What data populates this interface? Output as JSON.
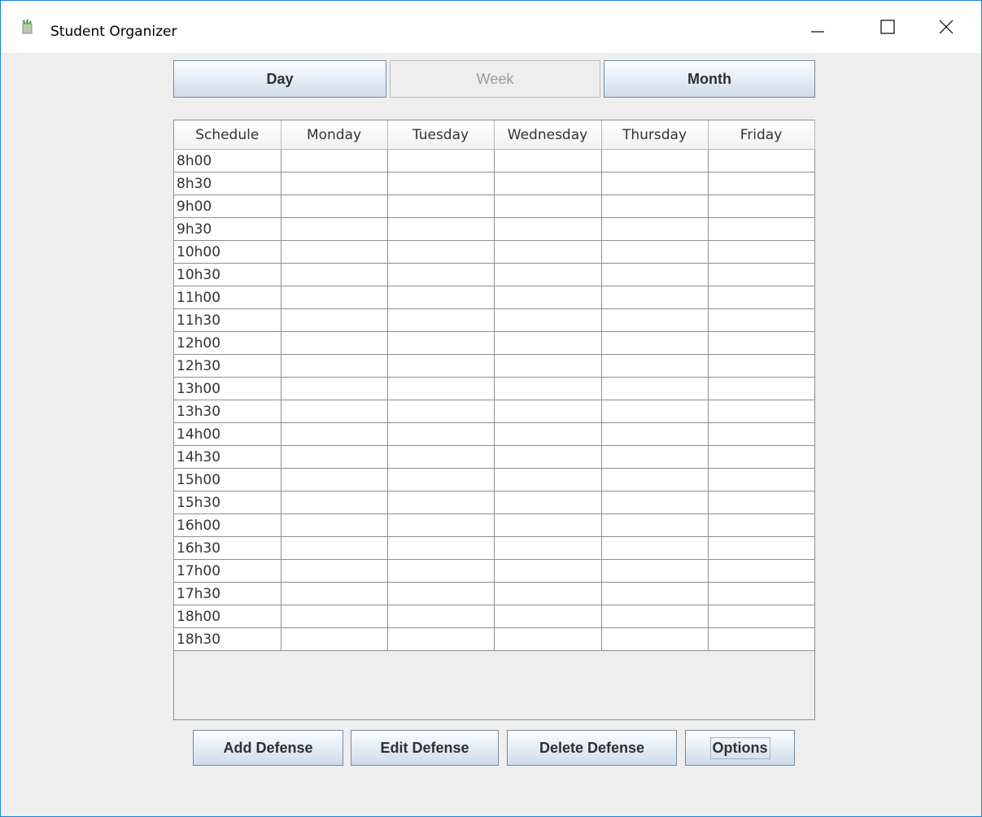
{
  "window": {
    "title": "Student Organizer",
    "accent": "#1883d7"
  },
  "icons": {
    "app": "app-icon",
    "minimize": "minimize-icon",
    "maximize": "maximize-icon",
    "close": "close-icon"
  },
  "view_switcher": {
    "day": "Day",
    "week": "Week",
    "month": "Month",
    "selected": "Week"
  },
  "schedule": {
    "columns": [
      "Schedule",
      "Monday",
      "Tuesday",
      "Wednesday",
      "Thursday",
      "Friday"
    ],
    "times": [
      "8h00",
      "8h30",
      "9h00",
      "9h30",
      "10h00",
      "10h30",
      "11h00",
      "11h30",
      "12h00",
      "12h30",
      "13h00",
      "13h30",
      "14h00",
      "14h30",
      "15h00",
      "15h30",
      "16h00",
      "16h30",
      "17h00",
      "17h30",
      "18h00",
      "18h30"
    ]
  },
  "actions": {
    "add": "Add Defense",
    "edit": "Edit Defense",
    "delete": "Delete Defense",
    "options": "Options"
  }
}
